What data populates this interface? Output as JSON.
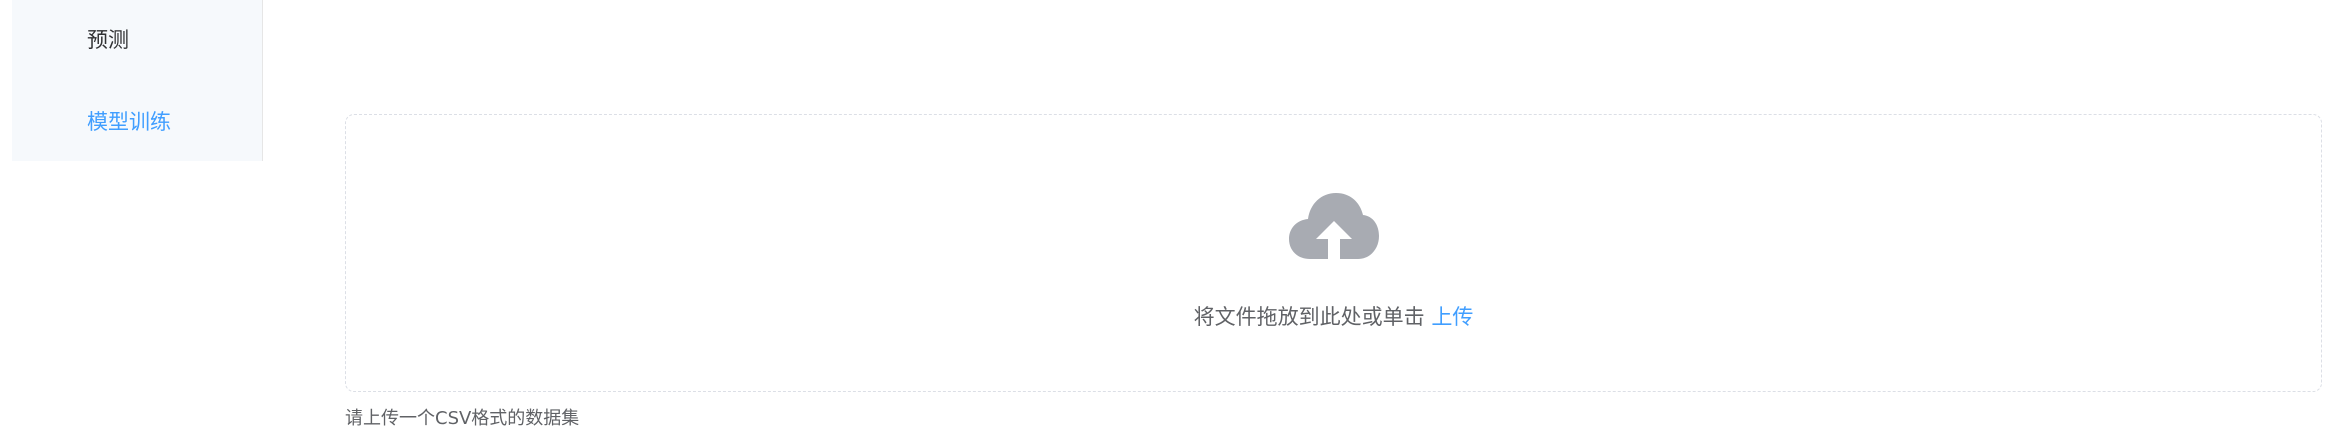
{
  "sidebar": {
    "items": [
      {
        "label": "预测",
        "active": false
      },
      {
        "label": "模型训练",
        "active": true
      }
    ]
  },
  "upload": {
    "drop_text": "将文件拖放到此处或单击",
    "link_text": "上传",
    "icon": "cloud-upload-icon"
  },
  "tip": "请上传一个CSV格式的数据集",
  "colors": {
    "accent": "#409eff",
    "text": "#606266",
    "sidebar_bg": "#f6f9fc",
    "icon": "#a8abb2"
  }
}
